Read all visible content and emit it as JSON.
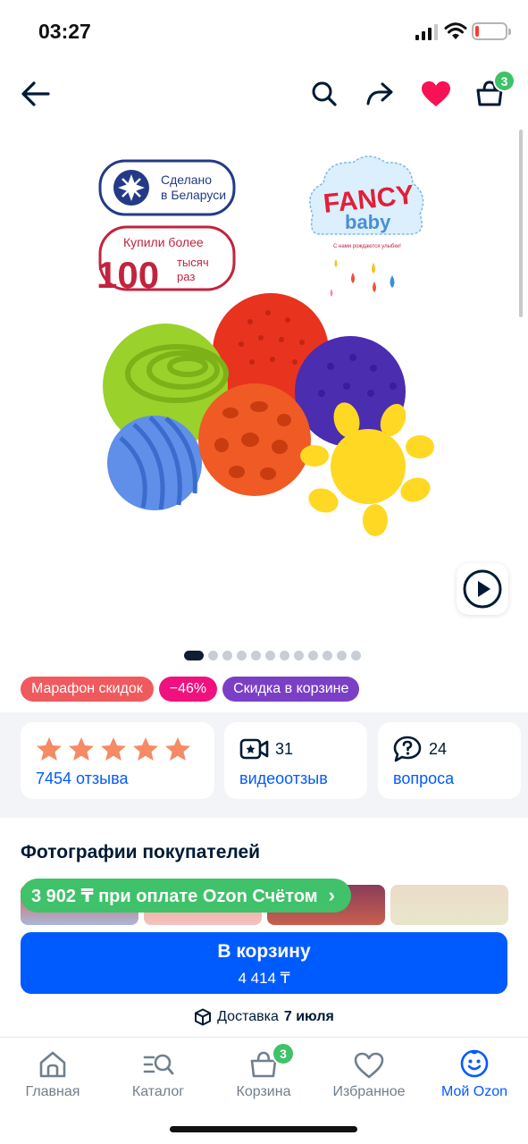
{
  "status_bar": {
    "time": "03:27"
  },
  "toolbar": {
    "cart_count": "3"
  },
  "product_image": {
    "made_in_line1": "Сделано",
    "made_in_line2": "в Беларуси",
    "bought_line1": "Купили более",
    "bought_number": "100",
    "bought_line2": "тысяч",
    "bought_line3": "раз",
    "brand_fancy": "FANCY",
    "brand_baby": "baby",
    "brand_slogan": "С нами рождаются улыбки!"
  },
  "gallery": {
    "image_count": 12,
    "active_index": 0
  },
  "badges": [
    {
      "label": "Марафон скидок",
      "color": "#f05a5f"
    },
    {
      "label": "−46%",
      "color": "#f1117e"
    },
    {
      "label": "Скидка в корзине",
      "color": "#7b3fc6"
    }
  ],
  "stats": {
    "rating_stars": 5,
    "reviews_label": "7454 отзыва",
    "video_count": "31",
    "video_label": "видеоотзыв",
    "questions_count": "24",
    "questions_label": "вопроса"
  },
  "customer_photos": {
    "title": "Фотографии покупателей"
  },
  "promo": {
    "label": "3 902 ₸ при оплате Ozon Счётом",
    "chevron": "›"
  },
  "buy_button": {
    "label": "В корзину",
    "price": "4 414 ₸"
  },
  "delivery": {
    "prefix": "Доставка",
    "date": "7 июля"
  },
  "tabbar": {
    "items": [
      {
        "label": "Главная",
        "icon": "home-icon"
      },
      {
        "label": "Каталог",
        "icon": "catalog-icon"
      },
      {
        "label": "Корзина",
        "icon": "cart-icon",
        "badge": "3"
      },
      {
        "label": "Избранное",
        "icon": "heart-icon"
      },
      {
        "label": "Мой Ozon",
        "icon": "profile-icon",
        "active": true
      }
    ]
  },
  "colors": {
    "accent": "#005bff",
    "green": "#3fc26a",
    "heart": "#f91155",
    "star": "#f58a64"
  }
}
